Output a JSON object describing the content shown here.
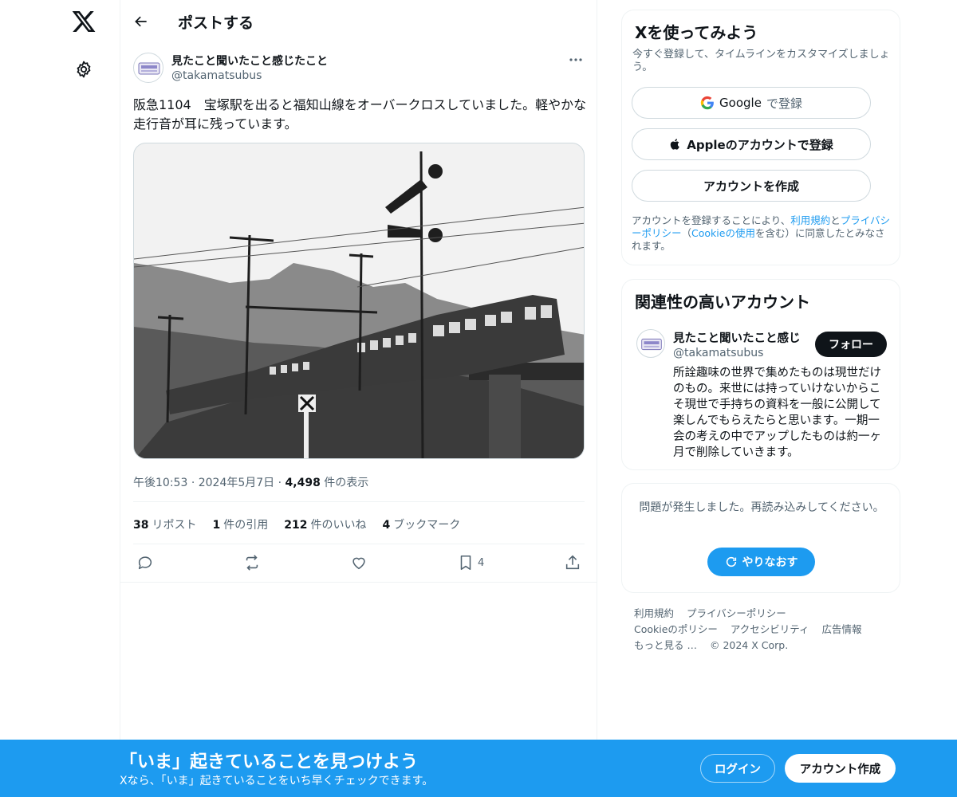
{
  "header": {
    "title": "ポストする"
  },
  "tweet": {
    "author_name": "見たこと聞いたこと感じたこと",
    "author_handle": "@takamatsubus",
    "text": "阪急1104　宝塚駅を出ると福知山線をオーバークロスしていました。軽やかな走行音が耳に残っています。",
    "time": "午後10:53",
    "date": "2024年5月7日",
    "views_count": "4,498",
    "views_label": "件の表示",
    "reposts_count": "38",
    "reposts_label": "リポスト",
    "quotes_count": "1",
    "quotes_label": "件の引用",
    "likes_count": "212",
    "likes_label": "件のいいね",
    "bookmarks_count": "4",
    "bookmarks_label": "ブックマーク",
    "bookmark_action_count": "4"
  },
  "signup": {
    "title": "Xを使ってみよう",
    "subtitle": "今すぐ登録して、タイムラインをカスタマイズしましょう。",
    "google_brand": "Google",
    "google_label": "で登録",
    "apple_label": "Appleのアカウントで登録",
    "create_label": "アカウントを作成",
    "legal_1": "アカウントを登録することにより、",
    "legal_terms": "利用規約",
    "legal_2": "と",
    "legal_privacy": "プライバシーポリシー",
    "legal_3": "（",
    "legal_cookie": "Cookieの使用",
    "legal_4": "を含む）に同意したとみなされます。"
  },
  "related": {
    "title": "関連性の高いアカウント",
    "name": "見たこと聞いたこと感じ",
    "handle": "@takamatsubus",
    "follow_label": "フォロー",
    "bio": "所詮趣味の世界で集めたものは現世だけのもの。来世には持っていけないからこそ現世で手持ちの資料を一般に公開して楽しんでもらえたらと思います。一期一会の考えの中でアップしたものは約一ヶ月で削除していきます。"
  },
  "error": {
    "text": "問題が発生しました。再読み込みしてください。",
    "retry_label": "やりなおす"
  },
  "footer": {
    "terms": "利用規約",
    "privacy": "プライバシーポリシー",
    "cookie": "Cookieのポリシー",
    "accessibility": "アクセシビリティ",
    "ads": "広告情報",
    "more": "もっと見る …",
    "copyright": "© 2024 X Corp."
  },
  "banner": {
    "title": "「いま」起きていることを見つけよう",
    "subtitle": "Xなら、「いま」起きていることをいち早くチェックできます。",
    "login_label": "ログイン",
    "create_label": "アカウント作成"
  },
  "colors": {
    "accent": "#1d9bf0",
    "text": "#0f1419",
    "muted": "#536471",
    "border": "#eff3f4"
  }
}
